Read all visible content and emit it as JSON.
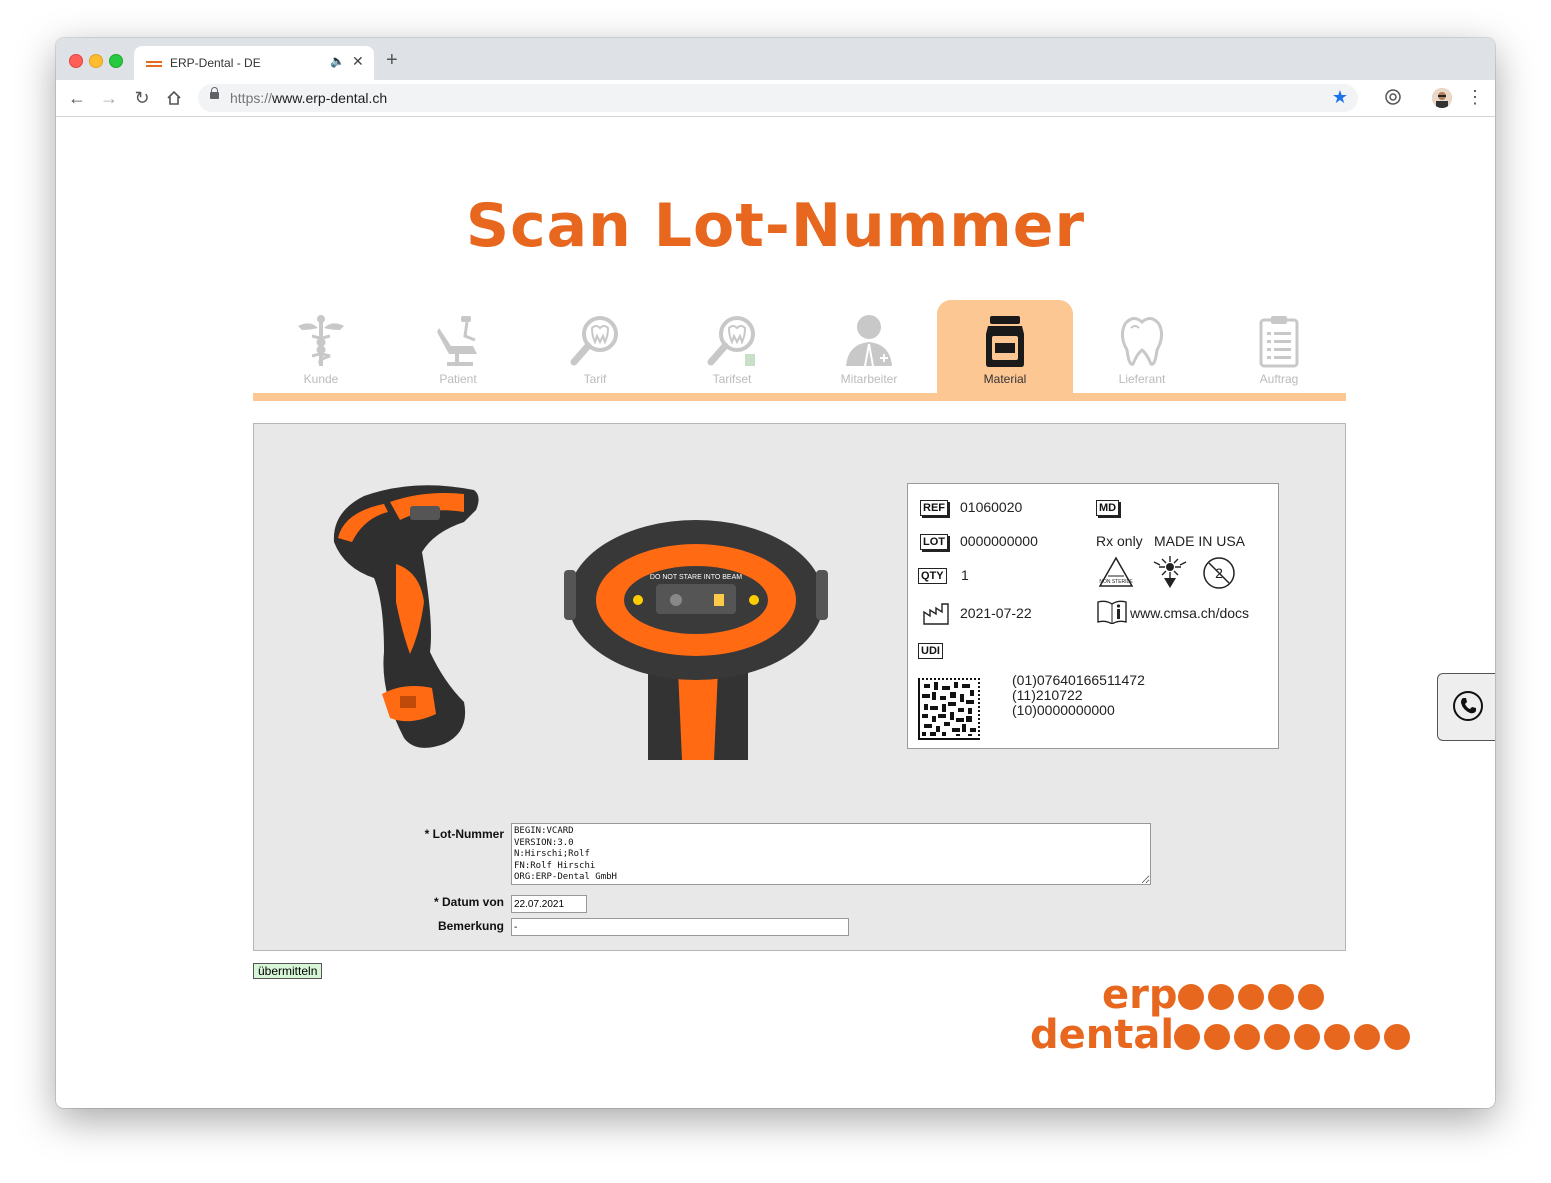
{
  "browser": {
    "tab_title": "ERP-Dental - DE",
    "url_scheme": "https://",
    "url_host": "www.erp-dental.ch"
  },
  "page": {
    "title": "Scan Lot-Nummer"
  },
  "steps": [
    {
      "label": "Kunde",
      "icon": "caduceus-icon",
      "active": false
    },
    {
      "label": "Patient",
      "icon": "dental-chair-icon",
      "active": false
    },
    {
      "label": "Tarif",
      "icon": "tooth-search-icon",
      "active": false
    },
    {
      "label": "Tarifset",
      "icon": "tooth-search-calculator-icon",
      "active": false
    },
    {
      "label": "Mitarbeiter",
      "icon": "employee-icon",
      "active": false
    },
    {
      "label": "Material",
      "icon": "jar-icon",
      "active": true
    },
    {
      "label": "Lieferant",
      "icon": "tooth-outline-icon",
      "active": false
    },
    {
      "label": "Auftrag",
      "icon": "clipboard-icon",
      "active": false
    }
  ],
  "label_card": {
    "ref_tag": "REF",
    "ref_value": "01060020",
    "md_tag": "MD",
    "lot_tag": "LOT",
    "lot_value": "0000000000",
    "rx_text": "Rx only",
    "made_in": "MADE IN USA",
    "qty_tag": "QTY",
    "qty_value": "1",
    "date_value": "2021-07-22",
    "docs_url": "www.cmsa.ch/docs",
    "udi_tag": "UDI",
    "udi_line1": "(01)07640166511472",
    "udi_line2": "(11)210722",
    "udi_line3": "(10)0000000000"
  },
  "scanner_text": "DO NOT STARE INTO BEAM",
  "form": {
    "lot_label": "* Lot-Nummer",
    "lot_value": "BEGIN:VCARD\nVERSION:3.0\nN:Hirschi;Rolf\nFN:Rolf Hirschi\nORG:ERP-Dental GmbH",
    "date_label": "* Datum von",
    "date_value": "22.07.2021",
    "note_label": "Bemerkung",
    "note_value": "-",
    "submit_label": "übermitteln"
  },
  "logo": {
    "word1": "erp",
    "word2": "dental"
  },
  "colors": {
    "accent": "#e8671e",
    "step_active": "#fdc794"
  }
}
